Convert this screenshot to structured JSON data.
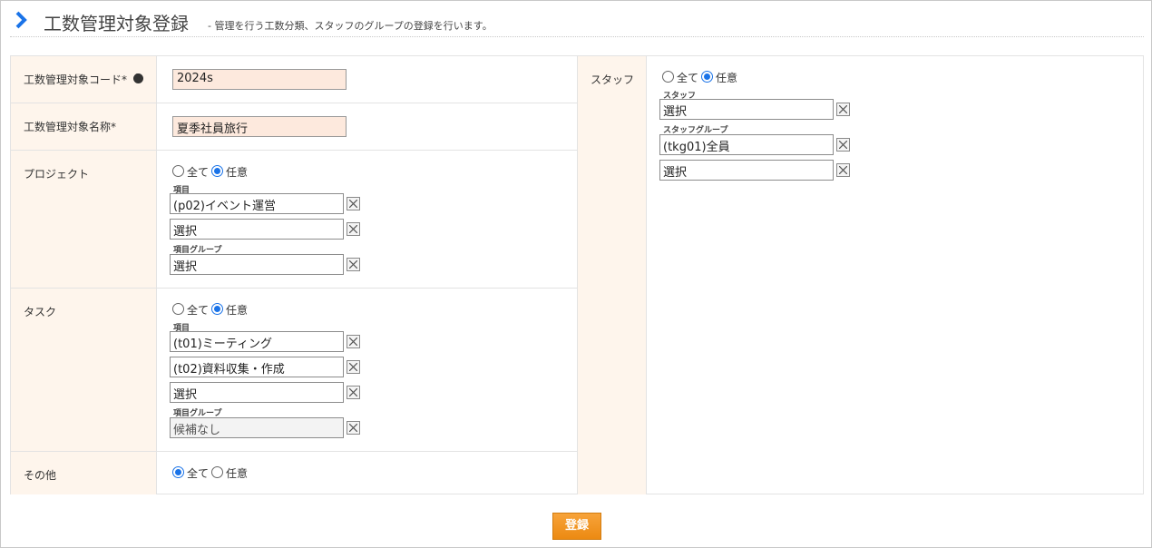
{
  "header": {
    "title": "工数管理対象登録",
    "subtitle": "- 管理を行う工数分類、スタッフのグループの登録を行います。",
    "icon": "chevron-right-icon",
    "accent": "#1a73e8"
  },
  "code": {
    "label": "工数管理対象コード",
    "required": "*",
    "value": "2024s"
  },
  "name": {
    "label": "工数管理対象名称",
    "required": "*",
    "value": "夏季社員旅行"
  },
  "project": {
    "label": "プロジェクト",
    "radio_all": "全て",
    "radio_any": "任意",
    "selected": "any",
    "items_label": "項目",
    "items": [
      "(p02)イベント運営",
      "選択"
    ],
    "group_label": "項目グループ",
    "groups": [
      "選択"
    ]
  },
  "task": {
    "label": "タスク",
    "radio_all": "全て",
    "radio_any": "任意",
    "selected": "any",
    "items_label": "項目",
    "items": [
      "(t01)ミーティング",
      "(t02)資料収集・作成",
      "選択"
    ],
    "group_label": "項目グループ",
    "groups": [
      "候補なし"
    ]
  },
  "other": {
    "label": "その他",
    "radio_all": "全て",
    "radio_any": "任意",
    "selected": "all"
  },
  "staff": {
    "label": "スタッフ",
    "radio_all": "全て",
    "radio_any": "任意",
    "selected": "any",
    "staff_label": "スタッフ",
    "staff_items": [
      "選択"
    ],
    "group_label": "スタッフグループ",
    "groups": [
      "(tkg01)全員",
      "選択"
    ]
  },
  "submit_label": "登録",
  "colors": {
    "label_bg": "#fef5ec",
    "input_bg": "#fde9dd",
    "button": "#ec8a12"
  }
}
